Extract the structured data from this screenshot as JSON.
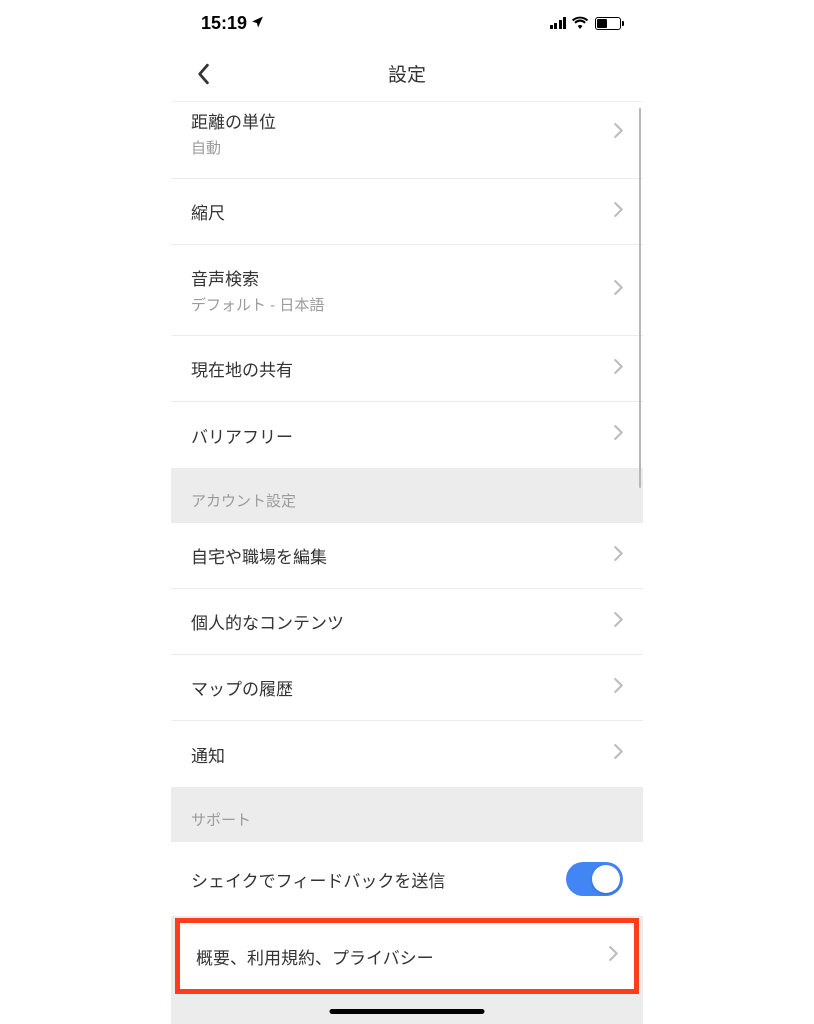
{
  "statusBar": {
    "time": "15:19"
  },
  "nav": {
    "title": "設定"
  },
  "section1": {
    "distanceUnit": {
      "label": "距離の単位",
      "sub": "自動"
    },
    "scale": {
      "label": "縮尺"
    },
    "voiceSearch": {
      "label": "音声検索",
      "sub": "デフォルト - 日本語"
    },
    "locationShare": {
      "label": "現在地の共有"
    },
    "accessibility": {
      "label": "バリアフリー"
    }
  },
  "section2": {
    "header": "アカウント設定",
    "editHomeWork": {
      "label": "自宅や職場を編集"
    },
    "personalContent": {
      "label": "個人的なコンテンツ"
    },
    "mapsHistory": {
      "label": "マップの履歴"
    },
    "notifications": {
      "label": "通知"
    }
  },
  "section3": {
    "header": "サポート",
    "shakeFeedback": {
      "label": "シェイクでフィードバックを送信",
      "toggle": true
    },
    "aboutTerms": {
      "label": "概要、利用規約、プライバシー"
    }
  }
}
